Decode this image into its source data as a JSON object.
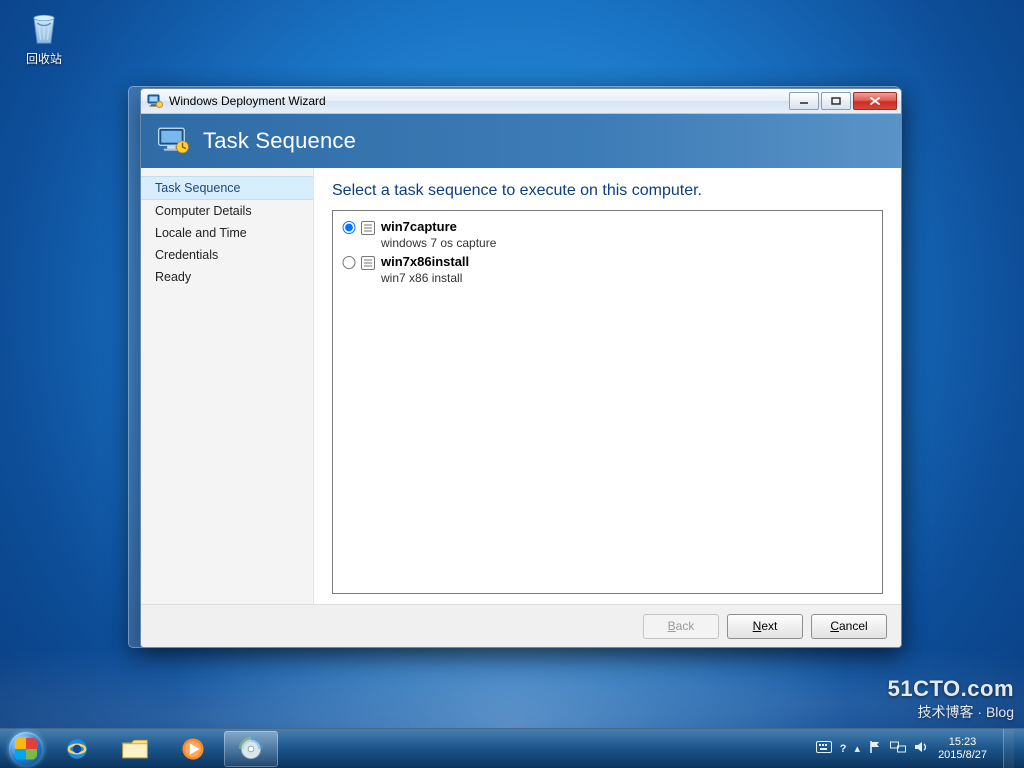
{
  "desktop": {
    "recycle_bin_label": "回收站",
    "watermark_line1": "51CTO.com",
    "watermark_line2": "技术博客 · Blog"
  },
  "taskbar": {
    "apps": {
      "ie": "Internet Explorer",
      "explorer": "File Explorer",
      "media": "Windows Media Player",
      "disc": "Windows Deployment"
    },
    "time": "15:23",
    "date": "2015/8/27"
  },
  "window": {
    "title": "Windows Deployment Wizard",
    "banner_title": "Task Sequence",
    "steps": [
      "Task Sequence",
      "Computer Details",
      "Locale and Time",
      "Credentials",
      "Ready"
    ],
    "active_step_index": 0,
    "content_heading": "Select a task sequence to execute on this computer.",
    "task_sequences": [
      {
        "name": "win7capture",
        "desc": "windows 7 os capture",
        "selected": true
      },
      {
        "name": "win7x86install",
        "desc": "win7 x86 install",
        "selected": false
      }
    ],
    "buttons": {
      "back": {
        "label": "Back",
        "hotkey": "B",
        "enabled": false
      },
      "next": {
        "label": "Next",
        "hotkey": "N",
        "enabled": true
      },
      "cancel": {
        "label": "Cancel",
        "hotkey": "C",
        "enabled": true
      }
    }
  }
}
